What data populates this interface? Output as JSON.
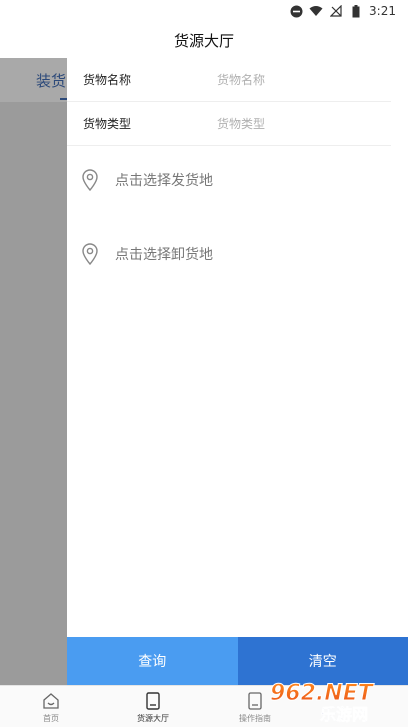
{
  "status_bar": {
    "time": "3:21"
  },
  "header": {
    "title": "货源大厅"
  },
  "background_tab": {
    "label": "装货"
  },
  "filter": {
    "fields": [
      {
        "label": "货物名称",
        "placeholder": "货物名称"
      },
      {
        "label": "货物类型",
        "placeholder": "货物类型"
      }
    ],
    "load_location": "点击选择发货地",
    "unload_location": "点击选择卸货地",
    "query_button": "查询",
    "clear_button": "清空"
  },
  "bottom_nav": {
    "items": [
      {
        "label": "首页",
        "icon": "home-icon"
      },
      {
        "label": "货源大厅",
        "icon": "cargo-hall-icon",
        "active": true
      },
      {
        "label": "操作指南",
        "icon": "guide-icon"
      }
    ]
  },
  "watermark": {
    "text": "962.NET",
    "subtext": "乐游网"
  },
  "colors": {
    "query_button": "#4a9cf1",
    "clear_button": "#2e73d2",
    "accent": "#2d4a7a"
  }
}
